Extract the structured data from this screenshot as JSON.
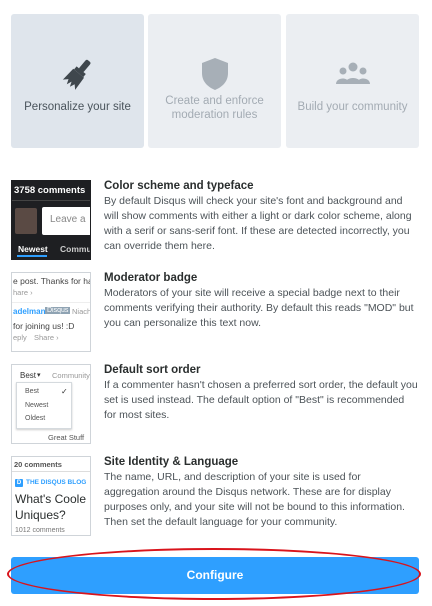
{
  "tabs": [
    {
      "label": "Personalize your site",
      "icon": "brush-icon"
    },
    {
      "label": "Create and enforce moderation rules",
      "icon": "shield-icon"
    },
    {
      "label": "Build your community",
      "icon": "community-icon"
    }
  ],
  "features": [
    {
      "title": "Color scheme and typeface",
      "desc": "By default Disqus will check your site's font and background and will show comments with either a light or dark color scheme, along with a serif or sans-serif font. If these are detected incorrectly, you can override them here.",
      "thumb": {
        "count": "3758 comments",
        "placeholder": "Leave a",
        "tab1": "Newest",
        "tab2": "Commun"
      }
    },
    {
      "title": "Moderator badge",
      "desc": "Moderators of your site will receive a special badge next to their comments verifying their authority. By default this reads \"MOD\" but you can personalize this text now.",
      "thumb": {
        "line1": "e post. Thanks for havin",
        "line2": "hare ›",
        "user": "adelman",
        "badge": "Disqus",
        "reply": "Niach",
        "line3": "for joining us! :D",
        "line4": "eply",
        "share": "Share ›"
      }
    },
    {
      "title": "Default sort order",
      "desc": "If a commenter hasn't chosen a preferred sort order, the default you set is used instead. The default option of \"Best\" is recommended for most sites.",
      "thumb": {
        "selected": "Best",
        "community": "Community",
        "options": [
          "Best",
          "Newest",
          "Oldest"
        ],
        "footer": "Great Stuff"
      }
    },
    {
      "title": "Site Identity & Language",
      "desc": "The name, URL, and description of your site is used for aggregation around the Disqus network. These are for display purposes only, and your site will not be bound to this information. Then set the default language for your community.",
      "thumb": {
        "count": "20 comments",
        "blog": "THE DISQUS BLOG",
        "headline1": "What's Coole",
        "headline2": "Uniques?",
        "footer": "1012 comments"
      }
    }
  ],
  "configure_label": "Configure",
  "colors": {
    "accent": "#2e9fff",
    "highlight": "#d9141c"
  }
}
